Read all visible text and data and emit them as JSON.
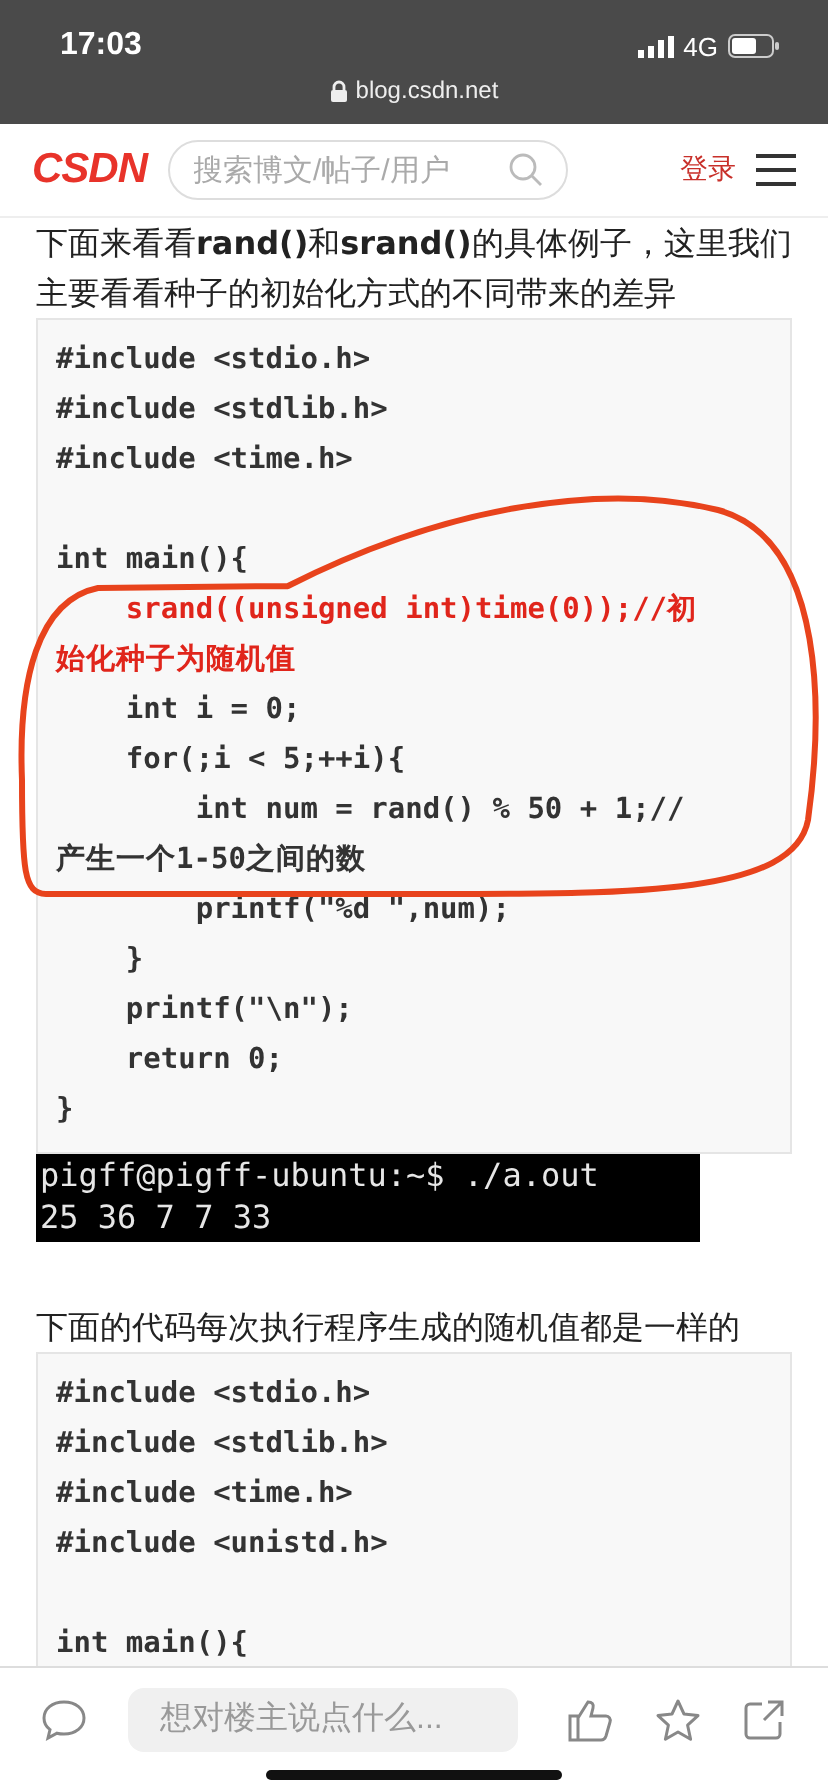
{
  "status_bar": {
    "time": "17:03",
    "network": "4G",
    "url": "blog.csdn.net"
  },
  "header": {
    "logo": "CSDN",
    "search": {
      "placeholder": "搜索博文/帖子/用户"
    },
    "login": "登录"
  },
  "article": [
    {
      "kind": "paragraph",
      "text": "下面来看看**rand()**和**srand()**的具体例子，这里我们主要看看种子的初始化方式的不同带来的差异"
    },
    {
      "kind": "code",
      "annotated": true,
      "lines": [
        {
          "text": "#include <stdio.h>",
          "kind": "plain"
        },
        {
          "text": "#include <stdlib.h>",
          "kind": "plain"
        },
        {
          "text": "#include <time.h>",
          "kind": "plain"
        },
        {
          "kind": "blank"
        },
        {
          "text": "int main(){",
          "kind": "plain"
        },
        {
          "text": "    srand((unsigned int)time(0));//初",
          "kind": "highlight"
        },
        {
          "text": "始化种子为随机值",
          "kind": "highlight"
        },
        {
          "text": "    int i = 0;",
          "kind": "plain"
        },
        {
          "text": "    for(;i < 5;++i){",
          "kind": "plain"
        },
        {
          "text": "        int num = rand() % 50 + 1;//",
          "kind": "plain"
        },
        {
          "text": "产生一个1-50之间的数",
          "kind": "plain"
        },
        {
          "text": "        printf(\"%d \",num);",
          "kind": "plain"
        },
        {
          "text": "    }",
          "kind": "plain"
        },
        {
          "text": "    printf(\"\\n\");",
          "kind": "plain"
        },
        {
          "text": "    return 0;",
          "kind": "plain"
        },
        {
          "text": "}",
          "kind": "plain"
        }
      ]
    },
    {
      "kind": "terminal",
      "lines": [
        "pigff@pigff-ubuntu:~$ ./a.out",
        "25 36 7 7 33"
      ]
    },
    {
      "kind": "paragraph",
      "text": "下面的代码每次执行程序生成的随机值都是一样的"
    },
    {
      "kind": "code",
      "annotated": false,
      "lines": [
        {
          "text": "#include <stdio.h>",
          "kind": "plain"
        },
        {
          "text": "#include <stdlib.h>",
          "kind": "plain"
        },
        {
          "text": "#include <time.h>",
          "kind": "plain"
        },
        {
          "text": "#include <unistd.h>",
          "kind": "plain"
        },
        {
          "kind": "blank"
        },
        {
          "text": "int main(){",
          "kind": "plain"
        }
      ]
    }
  ],
  "bottom_bar": {
    "comment_placeholder": "想对楼主说点什么..."
  }
}
